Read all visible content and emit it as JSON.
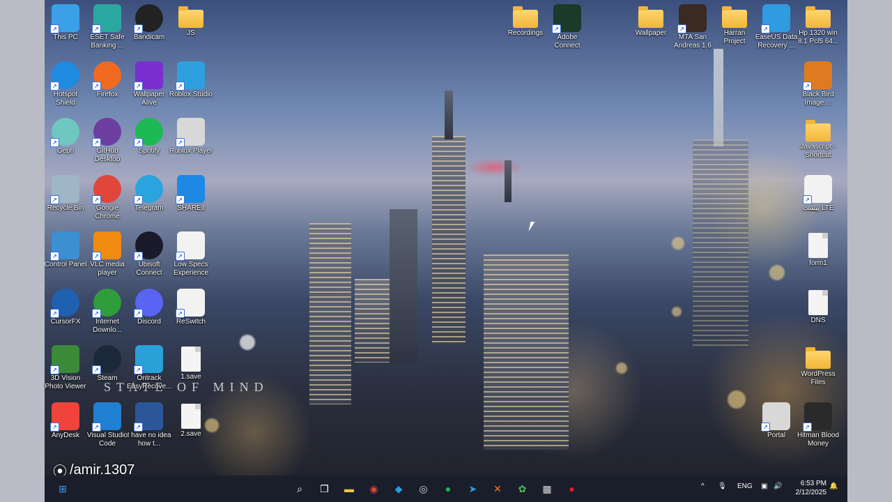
{
  "desktop_icons": [
    {
      "label": "This PC",
      "icon": "pc-icon",
      "kind": "glyph",
      "bg": "#3aa0e8",
      "col": 0,
      "row": 0
    },
    {
      "label": "ESET Safe Banking ...",
      "icon": "eset-icon",
      "kind": "glyph",
      "bg": "#2aa8a0",
      "col": 1,
      "row": 0
    },
    {
      "label": "Bandicam",
      "icon": "bandicam-icon",
      "kind": "round",
      "bg": "#222222",
      "col": 2,
      "row": 0
    },
    {
      "label": "JS",
      "icon": "folder-icon",
      "kind": "folder",
      "col": 3,
      "row": 0
    },
    {
      "label": "Hotspot Shield",
      "icon": "hotspot-shield-icon",
      "kind": "round",
      "bg": "#1c8be0",
      "col": 0,
      "row": 1
    },
    {
      "label": "Firefox",
      "icon": "firefox-icon",
      "kind": "round",
      "bg": "#f06a20",
      "col": 1,
      "row": 1
    },
    {
      "label": "Wallpaper Alive",
      "icon": "wallpaper-alive-icon",
      "kind": "glyph",
      "bg": "#7a2fd0",
      "col": 2,
      "row": 1
    },
    {
      "label": "Roblox Studio",
      "icon": "roblox-studio-icon",
      "kind": "glyph",
      "bg": "#2ea0e0",
      "col": 3,
      "row": 1
    },
    {
      "label": "Geph",
      "icon": "geph-icon",
      "kind": "round",
      "bg": "#6fc7c0",
      "col": 0,
      "row": 2
    },
    {
      "label": "GitHub Desktop",
      "icon": "github-icon",
      "kind": "round",
      "bg": "#6c3fa0",
      "col": 1,
      "row": 2
    },
    {
      "label": "Spotify",
      "icon": "spotify-icon",
      "kind": "round",
      "bg": "#1db954",
      "col": 2,
      "row": 2
    },
    {
      "label": "Roblox Player",
      "icon": "roblox-player-icon",
      "kind": "glyph",
      "bg": "#d8d8d8",
      "col": 3,
      "row": 2
    },
    {
      "label": "Recycle Bin",
      "icon": "recycle-bin-icon",
      "kind": "glyph",
      "bg": "#9fb6c8",
      "col": 0,
      "row": 3
    },
    {
      "label": "Google Chrome",
      "icon": "chrome-icon",
      "kind": "round",
      "bg": "#e0463a",
      "col": 1,
      "row": 3
    },
    {
      "label": "Telegram",
      "icon": "telegram-icon",
      "kind": "round",
      "bg": "#2aa3de",
      "col": 2,
      "row": 3
    },
    {
      "label": "SHAREit",
      "icon": "shareit-icon",
      "kind": "glyph",
      "bg": "#1e88e5",
      "col": 3,
      "row": 3
    },
    {
      "label": "Control Panel",
      "icon": "control-panel-icon",
      "kind": "glyph",
      "bg": "#3c8fd0",
      "col": 0,
      "row": 4
    },
    {
      "label": "VLC media player",
      "icon": "vlc-icon",
      "kind": "glyph",
      "bg": "#f08a10",
      "col": 1,
      "row": 4
    },
    {
      "label": "Ubisoft Connect",
      "icon": "ubisoft-icon",
      "kind": "round",
      "bg": "#1a1a2a",
      "col": 2,
      "row": 4
    },
    {
      "label": "Low Specs Experience",
      "icon": "lse-icon",
      "kind": "glyph",
      "bg": "#f2f2f2",
      "col": 3,
      "row": 4
    },
    {
      "label": "CursorFX",
      "icon": "cursorfx-icon",
      "kind": "round",
      "bg": "#2060b0",
      "col": 0,
      "row": 5
    },
    {
      "label": "Internet Downlo...",
      "icon": "idm-icon",
      "kind": "round",
      "bg": "#2f9d3a",
      "col": 1,
      "row": 5
    },
    {
      "label": "Discord",
      "icon": "discord-icon",
      "kind": "round",
      "bg": "#5865f2",
      "col": 2,
      "row": 5
    },
    {
      "label": "ReSwitch",
      "icon": "reswitch-icon",
      "kind": "glyph",
      "bg": "#f2f2f2",
      "col": 3,
      "row": 5
    },
    {
      "label": "3D Vision Photo Viewer",
      "icon": "3d-vision-icon",
      "kind": "glyph",
      "bg": "#3a8a3a",
      "col": 0,
      "row": 6
    },
    {
      "label": "Steam",
      "icon": "steam-icon",
      "kind": "round",
      "bg": "#1b2838",
      "col": 1,
      "row": 6
    },
    {
      "label": "Ontrack EasyRecove...",
      "icon": "ontrack-icon",
      "kind": "glyph",
      "bg": "#2aa0d8",
      "col": 2,
      "row": 6
    },
    {
      "label": "1.save",
      "icon": "file-icon",
      "kind": "doc",
      "col": 3,
      "row": 6
    },
    {
      "label": "AnyDesk",
      "icon": "anydesk-icon",
      "kind": "glyph",
      "bg": "#ef443b",
      "col": 0,
      "row": 7
    },
    {
      "label": "Visual Studio Code",
      "icon": "vscode-icon",
      "kind": "glyph",
      "bg": "#1f7fd0",
      "col": 1,
      "row": 7
    },
    {
      "label": "I have no idea how t...",
      "icon": "word-doc-icon",
      "kind": "glyph",
      "bg": "#2b579a",
      "col": 2,
      "row": 7
    },
    {
      "label": "2.save",
      "icon": "file-icon",
      "kind": "doc",
      "col": 3,
      "row": 7
    },
    {
      "label": "Recordings",
      "icon": "folder-icon",
      "kind": "folder",
      "col": 11,
      "row": 0
    },
    {
      "label": "Adobe Connect",
      "icon": "adobe-connect-icon",
      "kind": "glyph",
      "bg": "#1b3a2a",
      "col": 12,
      "row": 0
    },
    {
      "label": "Wallpaper",
      "icon": "folder-icon",
      "kind": "folder",
      "col": 14,
      "row": 0
    },
    {
      "label": "MTA San Andreas 1.6",
      "icon": "mta-icon",
      "kind": "glyph",
      "bg": "#3a2a22",
      "col": 15,
      "row": 0
    },
    {
      "label": "Harran Project",
      "icon": "folder-icon",
      "kind": "folder",
      "col": 16,
      "row": 0
    },
    {
      "label": "EaseUS Data Recovery ...",
      "icon": "easeus-icon",
      "kind": "glyph",
      "bg": "#2f9be0",
      "col": 17,
      "row": 0
    },
    {
      "label": "Hp 1320 win 8.1 Pcl5 64...",
      "icon": "folder-icon",
      "kind": "folder",
      "col": 18,
      "row": 0
    },
    {
      "label": "Black Bird Image ...",
      "icon": "blackbird-icon",
      "kind": "glyph",
      "bg": "#e07a20",
      "col": 18,
      "row": 1
    },
    {
      "label": "Javascript - Shortcut",
      "icon": "folder-icon",
      "kind": "folder",
      "col": 18,
      "row": 2
    },
    {
      "label": "پیست LTE",
      "icon": "pdf-doc-icon",
      "kind": "glyph",
      "bg": "#f2f2f2",
      "col": 18,
      "row": 3
    },
    {
      "label": "form1",
      "icon": "php-file-icon",
      "kind": "doc",
      "col": 18,
      "row": 4
    },
    {
      "label": "DNS",
      "icon": "file-icon",
      "kind": "doc",
      "col": 18,
      "row": 5
    },
    {
      "label": "WordPress Files",
      "icon": "folder-icon",
      "kind": "folder",
      "col": 18,
      "row": 6
    },
    {
      "label": "Portal",
      "icon": "portal-icon",
      "kind": "glyph",
      "bg": "#d8d8d8",
      "col": 17,
      "row": 7
    },
    {
      "label": "Hitman Blood Money",
      "icon": "hitman-icon",
      "kind": "glyph",
      "bg": "#2a2a2a",
      "col": 18,
      "row": 7
    }
  ],
  "wallpaper": {
    "overlay_text": "STATE OF MIND",
    "watermark": "/amir.1307"
  },
  "taskbar": {
    "apps": [
      {
        "name": "start-button",
        "glyph": "⊞",
        "color": "#3aa0ff"
      },
      {
        "name": "search-button",
        "glyph": "⌕",
        "color": "#ffffff"
      },
      {
        "name": "task-view-button",
        "glyph": "❐",
        "color": "#ffffff"
      },
      {
        "name": "file-explorer-taskbar",
        "glyph": "▬",
        "color": "#f2c040"
      },
      {
        "name": "chrome-taskbar",
        "glyph": "◉",
        "color": "#e0463a"
      },
      {
        "name": "vscode-taskbar",
        "glyph": "◆",
        "color": "#2a9be0"
      },
      {
        "name": "steam-taskbar",
        "glyph": "◎",
        "color": "#c8d8e8"
      },
      {
        "name": "spotify-taskbar",
        "glyph": "●",
        "color": "#1db954"
      },
      {
        "name": "telegram-taskbar",
        "glyph": "➤",
        "color": "#2aa3de"
      },
      {
        "name": "xampp-taskbar",
        "glyph": "✕",
        "color": "#f27a20"
      },
      {
        "name": "app-taskbar",
        "glyph": "✿",
        "color": "#4ac060"
      },
      {
        "name": "calculator-taskbar",
        "glyph": "▦",
        "color": "#dddddd"
      },
      {
        "name": "bandicam-taskbar",
        "glyph": "●",
        "color": "#e02020"
      }
    ],
    "tray": {
      "chevron": "^",
      "mic": "🎙",
      "language": "ENG",
      "network": "▣",
      "volume": "🔊",
      "time": "6:53 PM",
      "date": "2/12/2025",
      "notify": "🔔"
    }
  }
}
